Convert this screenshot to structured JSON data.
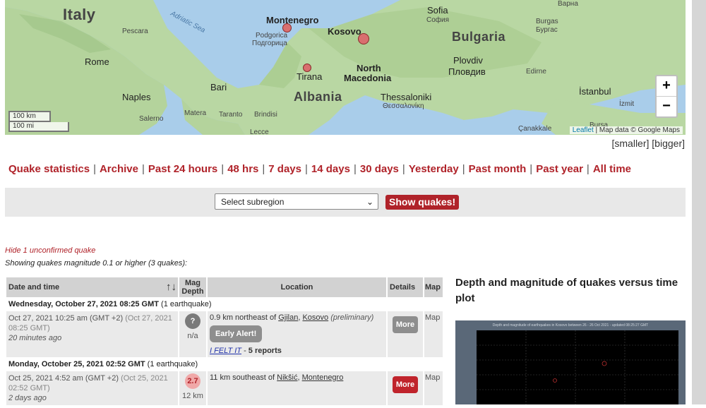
{
  "map": {
    "labels": {
      "italy": "Italy",
      "bulgaria": "Bulgaria",
      "albania": "Albania",
      "kosovo": "Kosovo",
      "north": "North",
      "macedonia": "Macedonia",
      "montenegro": "Montenegro",
      "sofia": "Sofia",
      "sofia_cyr": "София",
      "burgas": "Burgas",
      "burgas_cyr": "Бургас",
      "plovdiv": "Plovdiv",
      "plovdiv_cyr": "Пловдив",
      "edirne": "Edirne",
      "istanbul": "İstanbul",
      "izmit": "İzmit",
      "bursa": "Bursa",
      "canakkale": "Çanakkale",
      "thessaloniki": "Thessaloniki",
      "thessaloniki_gr": "Θεσσαλονίκη",
      "tirana": "Tirana",
      "podgorica": "Podgorica",
      "podgorica_cyr": "Подгорица",
      "rome": "Rome",
      "pescara": "Pescara",
      "naples": "Naples",
      "salerno": "Salerno",
      "bari": "Bari",
      "matera": "Matera",
      "taranto": "Taranto",
      "brindisi": "Brindisi",
      "lecce": "Lecce",
      "adriatic": "Adriatic Sea",
      "varna": "Варна"
    },
    "scale_km": "100 km",
    "scale_mi": "100 mi",
    "zoom_in": "+",
    "zoom_out": "−",
    "attribution_leaflet": "Leaflet",
    "attribution_rest": "| Map data © Google Maps",
    "colors": {
      "water": "#a9cdea",
      "land": "#b9d7a3",
      "quake": "#d96f6f"
    }
  },
  "sizer": {
    "smaller": "[smaller]",
    "bigger": "[bigger]"
  },
  "nav": {
    "items": [
      "Quake statistics",
      "Archive",
      "Past 24 hours",
      "48 hrs",
      "7 days",
      "14 days",
      "30 days",
      "Yesterday",
      "Past month",
      "Past year",
      "All time"
    ],
    "separator": "|"
  },
  "filter": {
    "subregion_selected": "Select subregion",
    "show_button": "Show quakes!"
  },
  "notes": {
    "hide_unconfirmed": "Hide 1 unconfirmed quake",
    "showing": "Showing quakes magnitude 0.1 or higher (3 quakes):"
  },
  "table": {
    "headers": {
      "date": "Date and time",
      "sort_icon": "↑↓",
      "mag": "Mag",
      "depth": "Depth",
      "location": "Location",
      "details": "Details",
      "map": "Map"
    },
    "groups": [
      {
        "day": "Wednesday, October 27, 2021 08:25 GMT",
        "count": "(1 earthquake)",
        "row": {
          "local": "Oct 27, 2021 10:25 am (GMT +2)",
          "gmt": "(Oct 27, 2021 08:25 GMT)",
          "ago": "20 minutes ago",
          "mag": "?",
          "depth": "n/a",
          "loc_pre": "0.9 km northeast of",
          "loc_city": "Gjilan",
          "loc_country": "Kosovo",
          "loc_note": "(preliminary)",
          "alert": "Early Alert!",
          "felt": "I FELT IT",
          "felt_sep": "-",
          "reports": "5 reports",
          "more": "More",
          "map": "Map",
          "mag_color": "#7a7a7a",
          "more_color": "#8e8e8e"
        }
      },
      {
        "day": "Monday, October 25, 2021 02:52 GMT",
        "count": "(1 earthquake)",
        "row": {
          "local": "Oct 25, 2021 4:52 am (GMT +2)",
          "gmt": "(Oct 25, 2021 02:52 GMT)",
          "ago": "2 days ago",
          "mag": "2.7",
          "depth": "12 km",
          "loc_pre": "11 km southeast of",
          "loc_city": "Nikšić",
          "loc_country": "Montenegro",
          "more": "More",
          "map": "Map",
          "mag_color": "#f0a8a8",
          "more_color": "#c0242c"
        }
      }
    ]
  },
  "plot": {
    "title": "Depth and magnitude of quakes versus time plot",
    "caption": "Depth and magnitude of earthquakes in Kosovo between 26 - 26 Oct 2021 - updated 08:25:27 GMT"
  }
}
